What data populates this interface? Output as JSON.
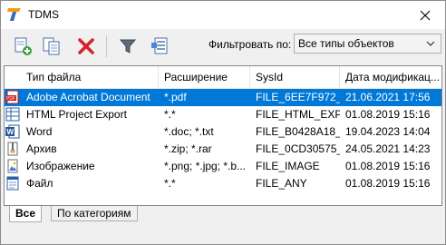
{
  "window": {
    "title": "TDMS"
  },
  "toolbar": {
    "filter_label": "Фильтровать по:",
    "filter_value": "Все типы объектов"
  },
  "columns": [
    "Тип файла",
    "Расширение",
    "SysId",
    "Дата модификац..."
  ],
  "rows": [
    {
      "icon": "pdf-icon",
      "type": "Adobe Acrobat Document",
      "ext": "*.pdf",
      "sysid": "FILE_6EE7F972_0...",
      "date": "21.06.2021 17:56",
      "selected": true
    },
    {
      "icon": "html-export-icon",
      "type": "HTML Project Export",
      "ext": "*.*",
      "sysid": "FILE_HTML_EXP...",
      "date": "01.08.2019 15:16"
    },
    {
      "icon": "word-icon",
      "type": "Word",
      "ext": "*.doc; *.txt",
      "sysid": "FILE_B0428A18_...",
      "date": "19.04.2023 14:04"
    },
    {
      "icon": "archive-icon",
      "type": "Архив",
      "ext": "*.zip; *.rar",
      "sysid": "FILE_0CD30575_...",
      "date": "24.05.2021 14:23"
    },
    {
      "icon": "image-icon",
      "type": "Изображение",
      "ext": "*.png; *.jpg; *.b...",
      "sysid": "FILE_IMAGE",
      "date": "01.08.2019 15:16"
    },
    {
      "icon": "file-icon",
      "type": "Файл",
      "ext": "*.*",
      "sysid": "FILE_ANY",
      "date": "01.08.2019 15:16"
    }
  ],
  "tabs": [
    {
      "label": "Все",
      "active": true
    },
    {
      "label": "По категориям",
      "active": false
    }
  ]
}
